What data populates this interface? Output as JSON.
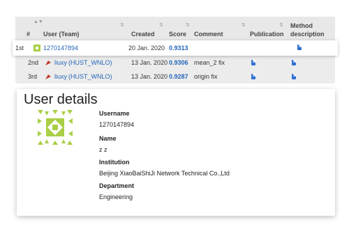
{
  "table": {
    "headers": {
      "rank": "#",
      "user": "User (Team)",
      "created": "Created",
      "score": "Score",
      "comment": "Comment",
      "publication": "Publication",
      "method_line1": "Method",
      "method_line2": "description"
    },
    "rows": [
      {
        "rank": "1st",
        "user": "1270147894",
        "team": "",
        "created": "20 Jan. 2020",
        "score": "0.9313",
        "comment": "",
        "publication": false,
        "method": true
      },
      {
        "rank": "2nd",
        "user": "liuxy",
        "team": "(HUST_WNLO)",
        "created": "13 Jan. 2020",
        "score": "0.9306",
        "comment": "mean_2 fix",
        "publication": true,
        "method": true
      },
      {
        "rank": "3rd",
        "user": "liuxy",
        "team": "(HUST_WNLO)",
        "created": "13 Jan. 2020",
        "score": "0.9287",
        "comment": "origin fix",
        "publication": true,
        "method": true
      }
    ]
  },
  "details": {
    "title": "User details",
    "username_label": "Username",
    "username": "1270147894",
    "name_label": "Name",
    "name": "z z",
    "institution_label": "Institution",
    "institution": "Beijing XiaoBaiShiJi Network Technical Co.,Ltd",
    "department_label": "Department",
    "department": "Engineering"
  },
  "colors": {
    "link": "#2466b8",
    "doc_icon": "#2f6fd0",
    "identicon": "#a9cf45"
  }
}
